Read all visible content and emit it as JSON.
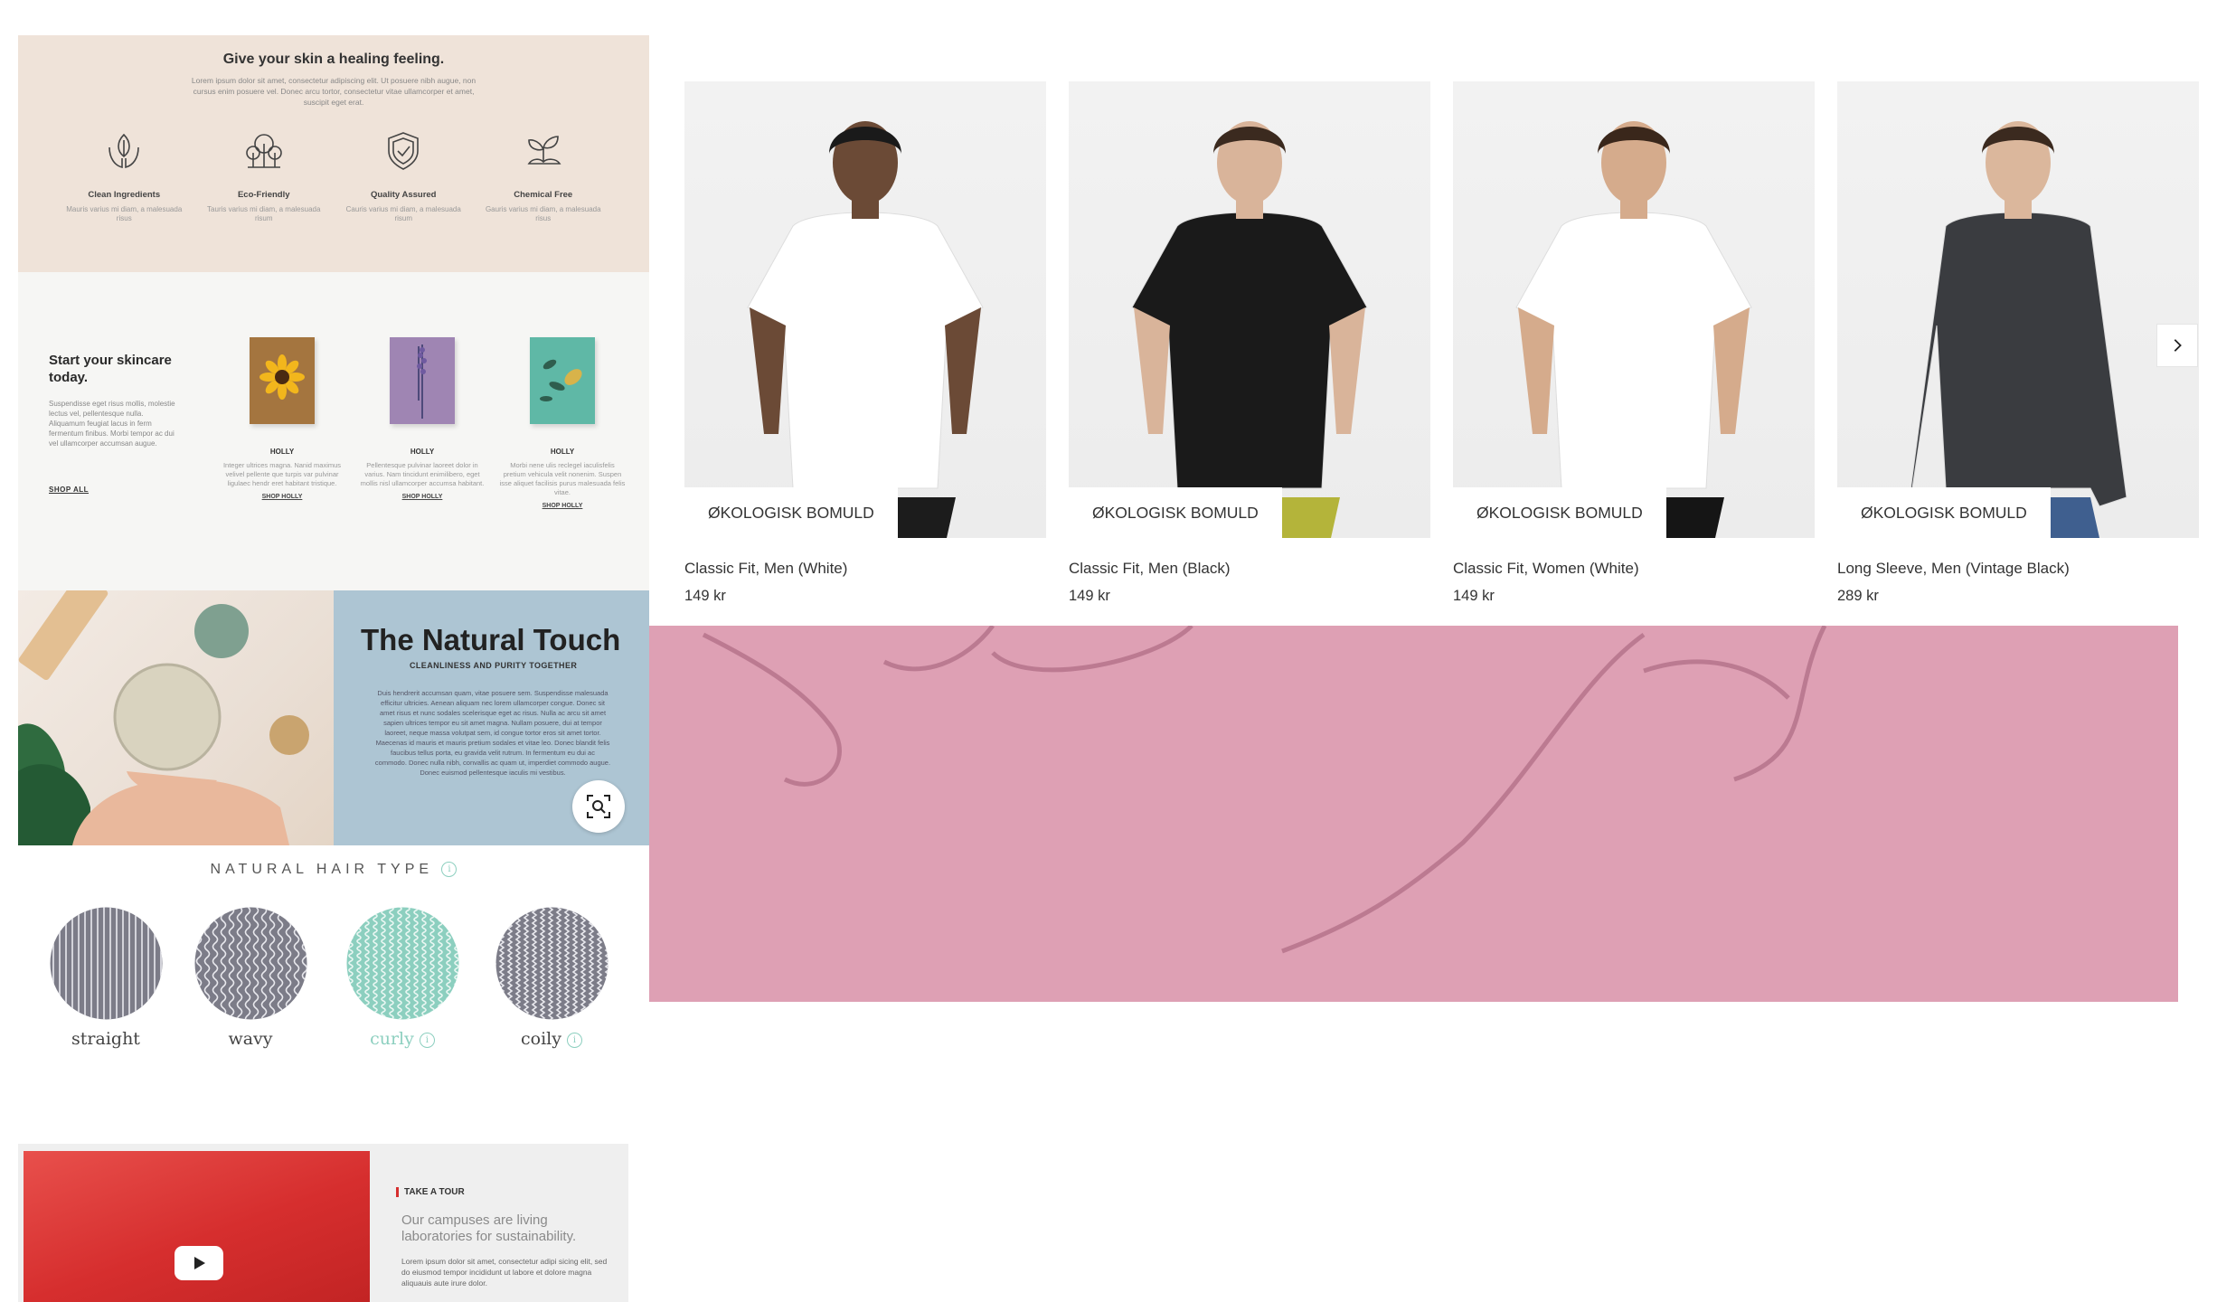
{
  "skin": {
    "title": "Give your skin a healing feeling.",
    "intro": "Lorem ipsum dolor sit amet, consectetur adipiscing elit. Ut posuere nibh augue, non cursus enim posuere vel. Donec arcu tortor, consectetur vitae ullamcorper et amet, suscipit eget erat.",
    "features": [
      {
        "icon": "hands-leaf-icon",
        "title": "Clean Ingredients",
        "desc": "Mauris varius mi diam, a malesuada risus"
      },
      {
        "icon": "trees-icon",
        "title": "Eco-Friendly",
        "desc": "Tauris varius mi diam, a malesuada risum"
      },
      {
        "icon": "shield-check-icon",
        "title": "Quality Assured",
        "desc": "Cauris varius mi diam, a malesuada risum"
      },
      {
        "icon": "sprout-icon",
        "title": "Chemical Free",
        "desc": "Gauris varius mi diam, a malesuada risus"
      }
    ]
  },
  "start": {
    "heading": "Start your skincare today.",
    "desc": "Suspendisse eget risus mollis, molestie lectus vel, pellentesque nulla. Aliquamum feugiat lacus in ferm fermentum finibus. Morbi tempor ac dui vel ullamcorper accumsan augue.",
    "shop_all": "SHOP ALL",
    "products": [
      {
        "name": "HOLLY",
        "desc": "Integer ultrices magna. Nanid maximus velivel pellente que turpis var pulvinar ligulaec hendr eret habitant tristique.",
        "cta": "SHOP HOLLY",
        "color": "#a4753f"
      },
      {
        "name": "HOLLY",
        "desc": "Pellentesque pulvinar laoreet dolor in varius. Nam tincidunt enimilibero, eget mollis nisl ullamcorper accumsa habitant.",
        "cta": "SHOP HOLLY",
        "color": "#9f85b3"
      },
      {
        "name": "HOLLY",
        "desc": "Morbi nene ulis reclegel iaculisfelis pretium vehicula velit nonenim. Suspen isse aliquet facilisis purus malesuada felis vitae.",
        "cta": "SHOP HOLLY",
        "color": "#5fb8a6"
      }
    ]
  },
  "natural": {
    "title": "The Natural Touch",
    "subtitle": "CLEANLINESS AND PURITY TOGETHER",
    "body": "Duis hendrerit accumsan quam, vitae posuere sem. Suspendisse malesuada efficitur ultricies. Aenean aliquam nec lorem ullamcorper congue. Donec sit amet risus et nunc sodales scelerisque eget ac risus. Nulla ac arcu sit amet sapien ultrices tempor eu sit amet magna. Nullam posuere, dui at tempor laoreet, neque massa volutpat sem, id congue tortor eros sit amet tortor. Maecenas id mauris et mauris pretium sodales et vitae leo. Donec blandit felis faucibus tellus porta, eu gravida velit rutrum. In fermentum eu dui ac commodo. Donec nulla nibh, convallis ac quam ut, imperdiet commodo augue. Donec euismod pellentesque iaculis mi vestibus."
  },
  "hair": {
    "title": "NATURAL HAIR TYPE",
    "types": [
      {
        "label": "straight",
        "pattern": "straight",
        "color": "#7c7c88",
        "info": false
      },
      {
        "label": "wavy",
        "pattern": "wavy",
        "color": "#7c7c88",
        "info": false
      },
      {
        "label": "curly",
        "pattern": "curly",
        "color": "#8ccfbf",
        "info": true
      },
      {
        "label": "coily",
        "pattern": "coily",
        "color": "#7c7c88",
        "info": true
      }
    ]
  },
  "tour": {
    "tag": "TAKE A TOUR",
    "heading": "Our campuses are living laboratories for sustainability.",
    "body": "Lorem ipsum dolor sit amet, consectetur adipi sicing elit, sed do eiusmod tempor incididunt ut labore et dolore magna aliquauis aute irure dolor."
  },
  "products": [
    {
      "badge": "ØKOLOGISK BOMULD",
      "name": "Classic Fit, Men (White)",
      "price": "149 kr",
      "shirt": "#ffffff",
      "bottom": "#1c1c1c",
      "skin": "#6b4a36",
      "hair": "#1a1a1a"
    },
    {
      "badge": "ØKOLOGISK BOMULD",
      "name": "Classic Fit, Men (Black)",
      "price": "149 kr",
      "shirt": "#1a1a1a",
      "bottom": "#b4b43a",
      "skin": "#d9b49a",
      "hair": "#3b2a1f"
    },
    {
      "badge": "ØKOLOGISK BOMULD",
      "name": "Classic Fit, Women (White)",
      "price": "149 kr",
      "shirt": "#ffffff",
      "bottom": "#151515",
      "skin": "#d5ab8c",
      "hair": "#3a271b"
    },
    {
      "badge": "ØKOLOGISK BOMULD",
      "name": "Long Sleeve, Men (Vintage Black)",
      "price": "289 kr",
      "shirt": "#3a3c40",
      "bottom": "#3f5f8f",
      "skin": "#dbb79c",
      "hair": "#3b2a1f"
    }
  ],
  "pink_color": "#dea0b4"
}
